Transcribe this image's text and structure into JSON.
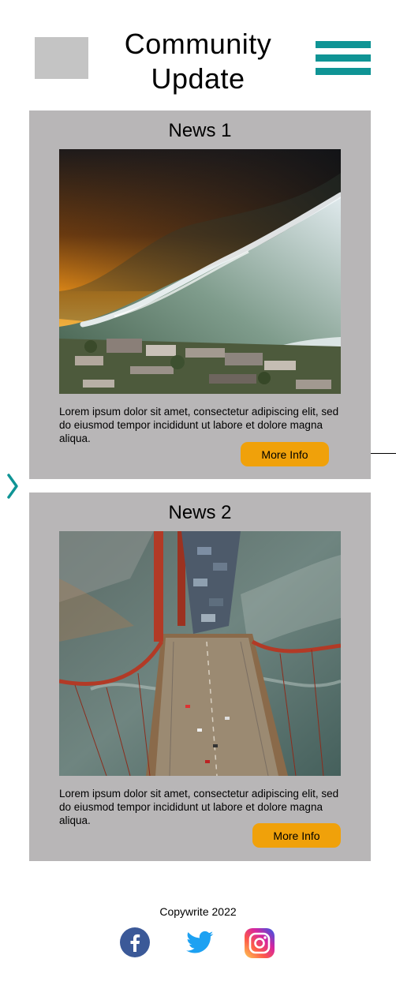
{
  "header": {
    "title_line1": "Community",
    "title_line2": "Update",
    "logo_icon": "logo-placeholder-icon",
    "menu_icon": "hamburger-menu-icon"
  },
  "nav": {
    "next_icon": "chevron-right-icon"
  },
  "colors": {
    "accent": "#0f9495",
    "card_bg": "#b8b6b7",
    "button": "#f0a10a",
    "logo_placeholder": "#c4c4c4"
  },
  "news": [
    {
      "title": "News 1",
      "image_icon": "tsunami-wave-image",
      "body": "Lorem ipsum dolor sit amet, consectetur adipiscing elit, sed do eiusmod tempor incididunt ut labore et dolore magna aliqua.",
      "button_label": "More Info"
    },
    {
      "title": "News 2",
      "image_icon": "bridge-flood-image",
      "body": "Lorem ipsum dolor sit amet, consectetur adipiscing elit, sed do eiusmod tempor incididunt ut labore et dolore magna aliqua.",
      "button_label": "More Info"
    }
  ],
  "footer": {
    "copyright": "Copywrite 2022",
    "social": [
      "facebook-icon",
      "twitter-icon",
      "instagram-icon"
    ]
  }
}
